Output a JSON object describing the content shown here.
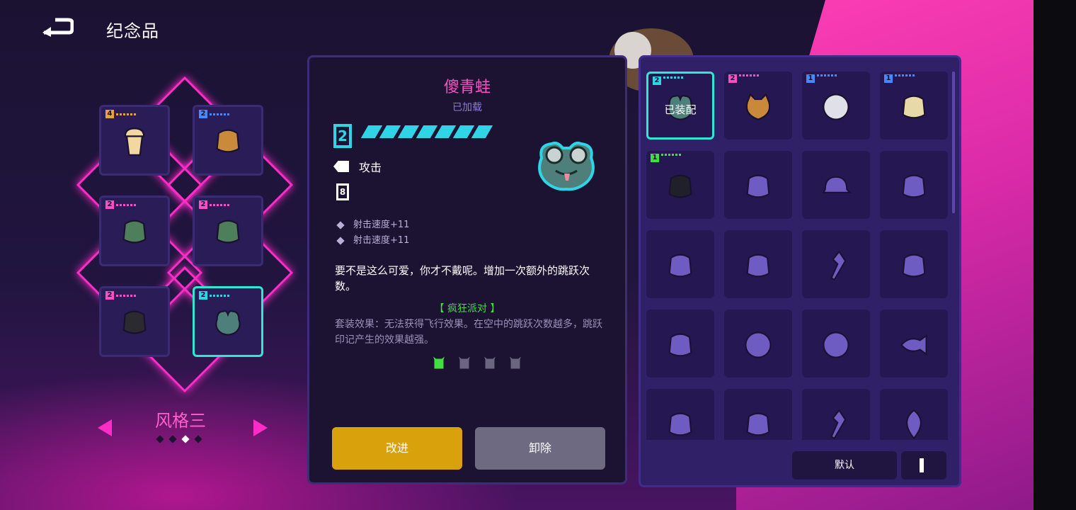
{
  "header": {
    "title": "纪念品"
  },
  "loadout": {
    "style_name": "风格三",
    "slots": [
      {
        "badge": "4",
        "badge_color": "#e7a23a",
        "icon": "popcorn-icon"
      },
      {
        "badge": "2",
        "badge_color": "#4a88ff",
        "icon": "mask-icon"
      },
      {
        "badge": "2",
        "badge_color": "#ff4fc4",
        "icon": "green-cross-chest-icon"
      },
      {
        "badge": "2",
        "badge_color": "#ff4fc4",
        "icon": "green-x-chest-icon"
      },
      {
        "badge": "2",
        "badge_color": "#ff4fc4",
        "icon": "shoe-icon"
      },
      {
        "badge": "2",
        "badge_color": "#2fd5e6",
        "icon": "frog-icon"
      }
    ],
    "pages": 4,
    "current_page": 3
  },
  "detail": {
    "name": "傻青蛙",
    "status": "已加载",
    "level": "2",
    "level_segments": 7,
    "tag": "攻击",
    "slot_num": "8",
    "stats": [
      "射击速度+11",
      "射击速度+11"
    ],
    "description": "要不是这么可爱，你才不戴呢。增加一次额外的跳跃次数。",
    "set_name": "【 疯狂派对 】",
    "set_effect": "套装效果：无法获得飞行效果。在空中的跳跃次数越多，跳跃印记产生的效果越强。",
    "set_progress": 1,
    "set_total": 4,
    "upgrade_label": "改进",
    "remove_label": "卸除"
  },
  "inventory": {
    "equipped_label": "已装配",
    "default_label": "默认",
    "items": [
      {
        "badge": "2",
        "badge_color": "#2fd5e6",
        "icon": "frog-icon",
        "equipped": true
      },
      {
        "badge": "2",
        "badge_color": "#ff4fc4",
        "icon": "owl-icon"
      },
      {
        "badge": "1",
        "badge_color": "#4a88ff",
        "icon": "astronaut-helmet-icon"
      },
      {
        "badge": "1",
        "badge_color": "#4a88ff",
        "icon": "calendar-card-icon"
      },
      {
        "badge": "1",
        "badge_color": "#40e040",
        "icon": "badge-shield-icon"
      },
      {
        "icon": "book-icon"
      },
      {
        "icon": "cap-icon"
      },
      {
        "icon": "scroll-icon"
      },
      {
        "icon": "mushroom-icon"
      },
      {
        "icon": "wallet-icon"
      },
      {
        "icon": "feather-icon"
      },
      {
        "icon": "frame-icon"
      },
      {
        "icon": "cat-statue-icon"
      },
      {
        "icon": "eye-disc-icon"
      },
      {
        "icon": "coin-icon"
      },
      {
        "icon": "fish-icon"
      },
      {
        "icon": "ghost-cat-icon"
      },
      {
        "icon": "crab-icon"
      },
      {
        "icon": "quill-icon"
      },
      {
        "icon": "leaf-icon"
      }
    ]
  }
}
